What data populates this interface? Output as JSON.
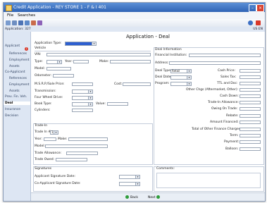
{
  "window": {
    "title": "Credit Application - REY STORE 1 - F & I 401"
  },
  "menu": {
    "file": "File",
    "searches": "Searches"
  },
  "breadcrumb": {
    "left": "Application: 327",
    "right": "US EN"
  },
  "sidebar": {
    "items": [
      {
        "label": "Applicant",
        "sub": false
      },
      {
        "label": "References",
        "sub": true
      },
      {
        "label": "Employment",
        "sub": true
      },
      {
        "label": "Assets",
        "sub": true
      },
      {
        "label": "Co-Applicant",
        "sub": false
      },
      {
        "label": "References",
        "sub": true
      },
      {
        "label": "Employment",
        "sub": true
      },
      {
        "label": "Assets",
        "sub": true
      },
      {
        "label": "Prev. Fin. Veh.",
        "sub": false
      },
      {
        "label": "Deal",
        "sub": false
      },
      {
        "label": "Insurance",
        "sub": false
      },
      {
        "label": "Decision",
        "sub": false
      }
    ]
  },
  "main": {
    "title": "Application - Deal",
    "application_type_label": "Application Type:",
    "vehicle": {
      "title": "Vehicle",
      "vin": "VIN:",
      "type": "Type:",
      "year": "Year:",
      "make": "Make:",
      "model": "Model:",
      "odometer": "Odometer:",
      "msrp": "M.S.R.P./Sale Price:",
      "cost": "Cost:",
      "transmission": "Transmission:",
      "fwd": "Four Wheel Drive:",
      "book_type": "Book Type:",
      "value": "Value:",
      "cylinders": "Cylinders:"
    },
    "deal": {
      "title": "Deal Information",
      "financial_institution": "Financial Institution:",
      "address": "Address:",
      "deal_type": "Deal Type:",
      "deal_type_value": "Retail",
      "deal_date": "Deal Date:",
      "program": "Program:",
      "cash_price": "Cash Price:",
      "sales_tax": "Sales Tax:",
      "ttl_doc": "TTL and Doc:",
      "other_chgs": "Other Chgs (Aftermarket, Other):",
      "cash_down": "Cash Down:",
      "trade_allowance": "Trade-In Allowance:",
      "owing_trade": "Owing On Trade:",
      "rebate": "Rebate:",
      "amount_financed": "Amount Financed:",
      "total_other": "Total of Other Finance Charges:",
      "term": "Term:",
      "payment": "Payment:",
      "balloon": "Balloon:"
    },
    "tradein": {
      "title": "Trade-In",
      "trade_in_num": "Trade In #",
      "trade_in_num_value": "1",
      "year": "Year:",
      "make": "Make:",
      "model": "Model:",
      "allowance": "Trade Allowance:",
      "owed": "Trade Owed:"
    },
    "signatures": {
      "title": "Signatures",
      "applicant": "Applicant Signature Date:",
      "coapplicant": "Co-Applicant Signature Date:"
    },
    "comments": {
      "title": "Comments:"
    }
  },
  "footer": {
    "back": "Back",
    "next": "Next"
  }
}
